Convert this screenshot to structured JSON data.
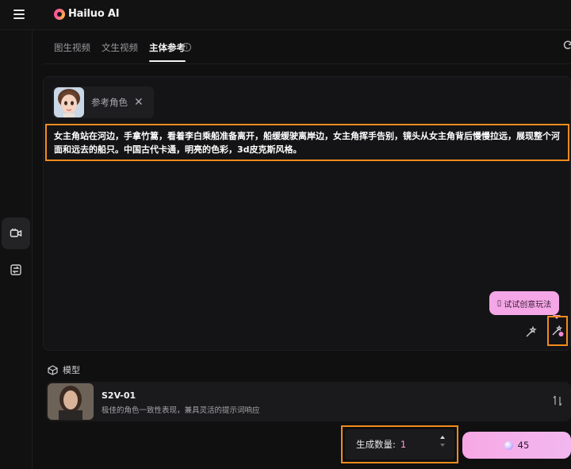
{
  "app": {
    "logo_text": "Hailuo AI"
  },
  "tabs": [
    {
      "label": "图生视频",
      "active": false
    },
    {
      "label": "文生视频",
      "active": false
    },
    {
      "label": "主体参考",
      "active": true
    }
  ],
  "reference": {
    "label": "参考角色",
    "close_glyph": "✕"
  },
  "prompt": {
    "text": "女主角站在河边，手拿竹篙，看着李白乘船准备离开，船缓缓驶离岸边，女主角挥手告别，镜头从女主角背后慢慢拉远，展现整个河面和远去的船只。中国古代卡通，明亮的色彩，3d皮克斯风格。"
  },
  "creative": {
    "tooltip": "试试创意玩法",
    "tooltip_glyph": "▯"
  },
  "model": {
    "heading": "模型",
    "name": "S2V-01",
    "description": "极佳的角色一致性表现，兼具灵活的提示词响应"
  },
  "generation": {
    "count_label": "生成数量:",
    "count_value": "1",
    "cost": "45"
  },
  "icons": {
    "menu": "menu-icon",
    "info": "info-icon",
    "refresh": "refresh-icon",
    "video_camera": "video-camera-icon",
    "image_swap": "image-swap-icon",
    "cube": "cube-icon",
    "magic": "magic-wand-icon",
    "creative": "creative-icon",
    "sort": "sort-icon",
    "credit": "credit-icon"
  },
  "colors": {
    "accent_pink": "#f5a6e6",
    "highlight_orange": "#f28b1c",
    "background": "#101011"
  }
}
